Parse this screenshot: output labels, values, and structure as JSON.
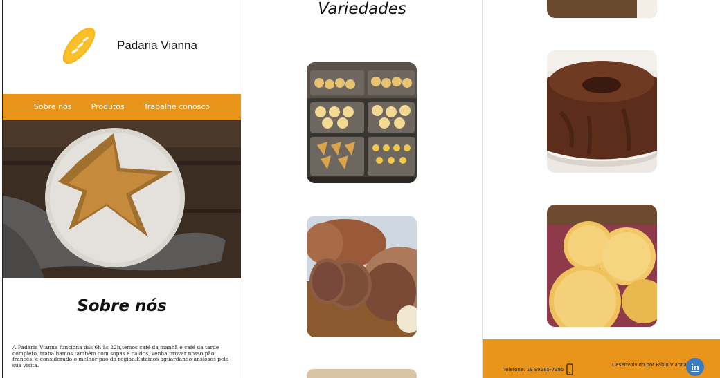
{
  "brand": {
    "name": "Padaria Vianna",
    "logo_icon": "bread-loaf-icon"
  },
  "nav": {
    "items": [
      "Sobre nós",
      "Produtos",
      "Trabalhe conosco"
    ]
  },
  "about": {
    "title": "Sobre nós",
    "text": "A Padaria Vianna funciona das 6h às 22h,temos café da manhã e café da tarde completo, trabalhamos também com sopas e caldos, venha provar nosso pão francês, é considerado o melhor pão da região.Estamos aguardando ansiosos pela sua visita."
  },
  "products": {
    "title": "Variedades",
    "images": [
      "pastry-display-image",
      "rye-bread-image",
      "chocolate-cake-image",
      "cheese-bread-image"
    ]
  },
  "footer": {
    "phone": "Telefone: 19 99285-7395",
    "phone_icon": "phone-icon",
    "developer": "Desenvolvido por Fábio Vianna",
    "linkedin_icon": "linkedin-icon",
    "linkedin_text": "in"
  },
  "colors": {
    "accent": "#e8941a",
    "text": "#111111",
    "background": "#ffffff"
  }
}
